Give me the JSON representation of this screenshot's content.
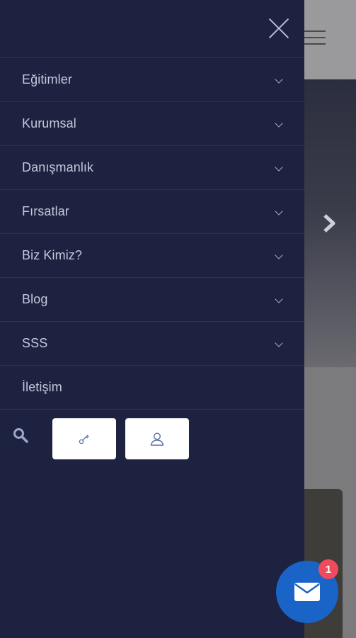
{
  "menu": {
    "items": [
      {
        "label": "Eğitimler",
        "has_submenu": true
      },
      {
        "label": "Kurumsal",
        "has_submenu": true
      },
      {
        "label": "Danışmanlık",
        "has_submenu": true
      },
      {
        "label": "Fırsatlar",
        "has_submenu": true
      },
      {
        "label": "Biz Kimiz?",
        "has_submenu": true
      },
      {
        "label": "Blog",
        "has_submenu": true
      },
      {
        "label": "SSS",
        "has_submenu": true
      },
      {
        "label": "İletişim",
        "has_submenu": false
      }
    ]
  },
  "icons": {
    "close": "close-icon",
    "search": "search-icon",
    "login": "key-icon",
    "account": "user-icon",
    "mail": "mail-icon",
    "hamburger": "hamburger-icon",
    "slider_next": "chevron-right-icon"
  },
  "mail": {
    "badge_count": "1"
  },
  "colors": {
    "drawer_bg": "#1c2240",
    "menu_text": "#c5c8dc",
    "fab_bg": "#1a64c8",
    "badge_bg": "#ef4b5d"
  }
}
